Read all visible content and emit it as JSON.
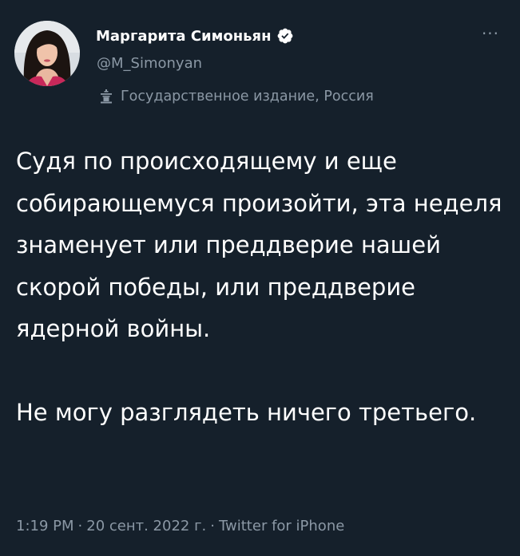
{
  "author": {
    "display_name": "Маргарита Симоньян",
    "handle": "@M_Simonyan",
    "verified": true,
    "label": "Государственное издание, Россия",
    "label_icon": "podium-icon"
  },
  "tweet": {
    "paragraphs": [
      "Судя по происходящему и еще собирающемуся произойти, эта неделя знаменует или преддверие нашей скорой победы, или преддверие ядерной войны.",
      "Не могу разглядеть ничего третьего."
    ]
  },
  "meta": {
    "time": "1:19 PM",
    "separator": "·",
    "date": "20 сент. 2022 г.",
    "source": "Twitter for iPhone"
  },
  "colors": {
    "background": "#15202b",
    "primary_text": "#ffffff",
    "secondary_text": "#8b98a5",
    "verified_badge": "#ffffff"
  }
}
